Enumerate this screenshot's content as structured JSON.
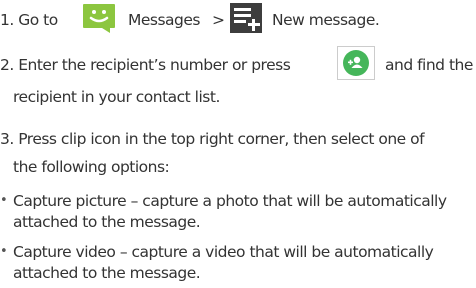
{
  "steps": {
    "step1": {
      "prefix": "1. Go to",
      "separator": ">",
      "messages_label": "Messages",
      "new_message_label": "New message.",
      "messages_icon_color": "#8cc63f",
      "new_message_icon_color": "#3d3d3d"
    },
    "step2": {
      "line1_a": "2. Enter the recipient’s number or press",
      "line1_b": "and find the",
      "line2": "recipient in your contact list.",
      "contact_icon_color": "#45b65a"
    },
    "step3": {
      "line1": "3. Press clip icon in the top right corner, then select one of",
      "line2": "the following options:"
    }
  },
  "options": [
    {
      "line1": "Capture picture – capture a photo that will be automatically",
      "line2": "attached to the message."
    },
    {
      "line1": "Capture video – capture a video that will be automatically",
      "line2": "attached to the message."
    }
  ]
}
